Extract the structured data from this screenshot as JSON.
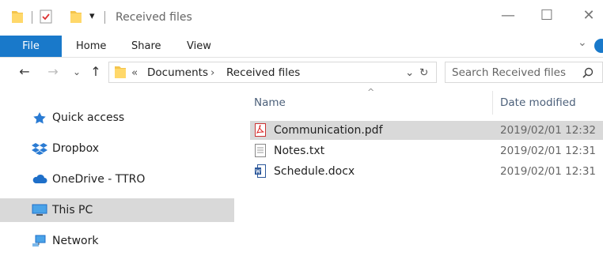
{
  "window": {
    "title": "Received files",
    "minimize_glyph": "—",
    "maximize_glyph": "☐",
    "close_glyph": "✕",
    "dropdown_glyph": "▾"
  },
  "ribbon": {
    "tabs": [
      "File",
      "Home",
      "Share",
      "View"
    ],
    "expand_glyph": "⌄",
    "accent_color": "#1979ca"
  },
  "address": {
    "back_glyph": "←",
    "forward_glyph": "→",
    "recent_glyph": "⌄",
    "up_glyph": "↑",
    "overflow": "«",
    "crumbs": [
      "Documents",
      "Received files"
    ],
    "crumb_sep": "›",
    "dropdown_glyph": "⌄",
    "refresh_glyph": "↻"
  },
  "search": {
    "placeholder": "Search Received files",
    "icon": "search-icon"
  },
  "nav": {
    "items": [
      {
        "label": "Quick access",
        "icon": "star-icon"
      },
      {
        "label": "Dropbox",
        "icon": "dropbox-icon"
      },
      {
        "label": "OneDrive - TTRO",
        "icon": "cloud-icon"
      },
      {
        "label": "This PC",
        "icon": "monitor-icon",
        "selected": true
      },
      {
        "label": "Network",
        "icon": "network-icon"
      }
    ]
  },
  "list": {
    "columns": {
      "name": "Name",
      "date": "Date modified"
    },
    "sort_glyph": "^",
    "files": [
      {
        "name": "Communication.pdf",
        "date": "2019/02/01 12:32",
        "icon": "pdf-icon",
        "highlight": true
      },
      {
        "name": "Notes.txt",
        "date": "2019/02/01 12:31",
        "icon": "text-file-icon"
      },
      {
        "name": "Schedule.docx",
        "date": "2019/02/01 12:31",
        "icon": "word-doc-icon"
      }
    ]
  }
}
